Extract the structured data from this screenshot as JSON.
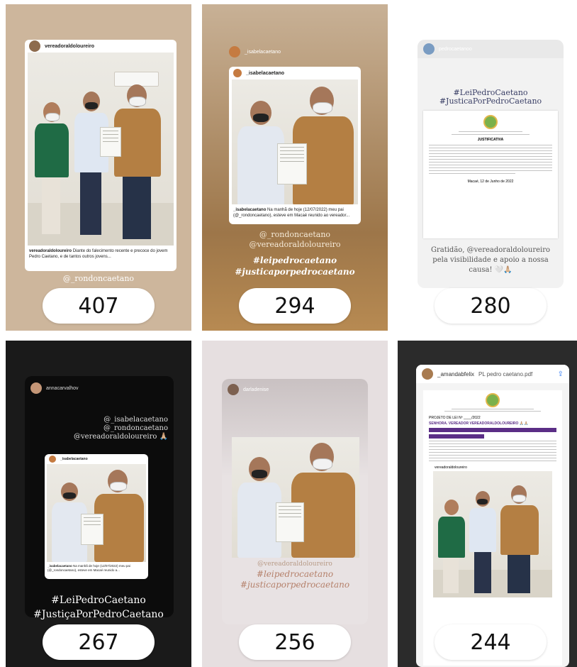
{
  "tiles": [
    {
      "count": "407",
      "user": "vereadoraldoloureiro",
      "caption_user": "vereadoraldoloureiro",
      "caption": "Diante do falecimento recente e precoce do jovem Pedro Caetano, e de tantos outros jovens...",
      "mention": "@_rondoncaetano"
    },
    {
      "count": "294",
      "user": "_isabelacaetano",
      "post_user": "_isabelacaetano",
      "caption_user": "_isabelacaetano",
      "caption": "Na manhã de hoje (12/07/2022) meu pai (@_rondoncaetano), esteve em Macaé reunido ao vereador...",
      "mention1": "@_rondoncaetano",
      "mention2": "@vereadoraldoloureiro",
      "tag1": "#leipedrocaetano",
      "tag2": "#justicaporpedrocaetano"
    },
    {
      "count": "280",
      "user": "pedrocaetanoo",
      "tag1": "#LeiPedroCaetano",
      "tag2": "#JusticaPorPedroCaetano",
      "doc_title": "JUSTIFICATIVA",
      "doc_place": "Macaé, 12 de Junho de 2022",
      "thanks": "Gratidão, @vereadoraldoloureiro pela visibilidade e apoio a nossa causa! 🤍🙏🏼"
    },
    {
      "count": "267",
      "user": "annacarvalhov",
      "mention1": "@_isabelacaetano",
      "mention2": "@_rondoncaetano",
      "mention3": "@vereadoraldoloureiro 🙏🏼",
      "post_user": "_isabelacaetano",
      "caption_user": "_isabelacaetano",
      "caption": "Na manhã de hoje (12/07/2022) meu pai (@_rondoncaetano), esteve em Macaé reunido a...",
      "tag1": "#LeiPedroCaetano",
      "tag2": "#JustiçaPorPedroCaetano"
    },
    {
      "count": "256",
      "user": "darladenise",
      "mention": "@vereadoraldoloureiro",
      "tag1": "#leipedrocaetano",
      "tag2": "#justicaporpedrocaetano"
    },
    {
      "count": "244",
      "user": "_amandabfelix",
      "file": "PL pedro caetano.pdf",
      "doc_label": "PROJETO DE LEI Nº ____/2022",
      "highlight": "SENHORA. VEREADOR VEREADORALDOLOUREIRO 🙏🏼🙏🏼",
      "photo_user": "vereadoraldoloureiro"
    }
  ],
  "colors": {
    "pill_bg": "#ffffff",
    "tile1_bg": "#cbb49a",
    "tile2_bg": "#a9865f",
    "tile4_bg": "#111111",
    "tile5_bg": "#e5e0e0"
  }
}
